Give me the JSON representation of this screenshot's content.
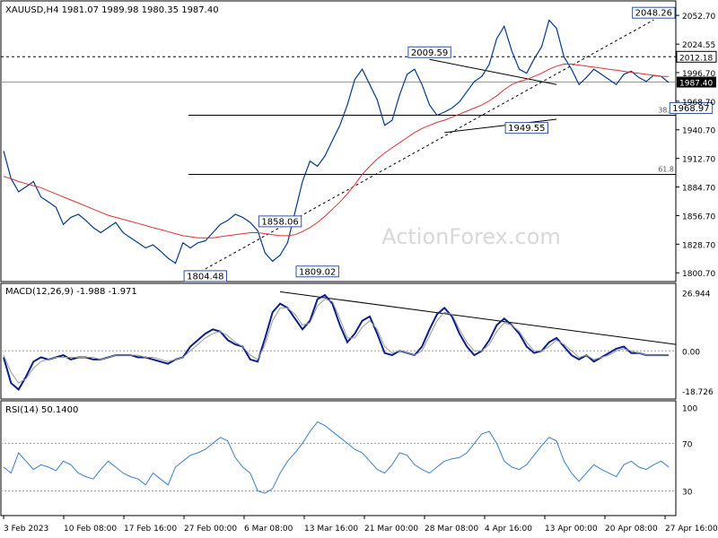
{
  "chart_data": {
    "type": "line",
    "watermark": "ActionForex.com",
    "main": {
      "title": "XAUUSD,H4  1981.07 1989.98 1980.35 1987.40",
      "ylim": [
        1793,
        2066
      ],
      "yticks": [
        "2052.70",
        "2024.55",
        "1996.70",
        "1968.70",
        "1940.70",
        "1912.70",
        "1884.70",
        "1856.70",
        "1828.70",
        "1800.70"
      ],
      "last_price": "1987.40",
      "level_price": "2012.18",
      "fib_levels": [
        {
          "label": "38.2",
          "value": 1955.0
        },
        {
          "label": "61.8",
          "value": 1897.0
        }
      ],
      "annotations": [
        {
          "label": "1804.48",
          "x": 27,
          "value": 1804.48
        },
        {
          "label": "1858.06",
          "x": 37,
          "value": 1858.06
        },
        {
          "label": "1809.02",
          "x": 42,
          "value": 1809.02
        },
        {
          "label": "2009.59",
          "x": 57,
          "value": 2009.59
        },
        {
          "label": "1949.55",
          "x": 70,
          "value": 1949.55
        },
        {
          "label": "2048.26",
          "x": 87,
          "value": 2048.26
        },
        {
          "label": "1968.97",
          "x": 92,
          "value": 1968.97
        }
      ],
      "series": [
        {
          "color": "#003a8c",
          "values": [
            1920,
            1893,
            1880,
            1885,
            1890,
            1875,
            1870,
            1865,
            1848,
            1855,
            1858,
            1852,
            1845,
            1840,
            1845,
            1850,
            1840,
            1835,
            1830,
            1825,
            1828,
            1822,
            1815,
            1810,
            1830,
            1825,
            1830,
            1832,
            1840,
            1848,
            1852,
            1858,
            1855,
            1850,
            1842,
            1820,
            1812,
            1818,
            1830,
            1860,
            1890,
            1910,
            1905,
            1915,
            1930,
            1945,
            1965,
            1990,
            2000,
            1985,
            1970,
            1945,
            1950,
            1975,
            1995,
            2000,
            1985,
            1965,
            1955,
            1958,
            1962,
            1968,
            1978,
            1988,
            1993,
            2005,
            2030,
            2042,
            2018,
            2000,
            1996,
            2010,
            2022,
            2048,
            2040,
            2012,
            2000,
            1985,
            1992,
            2000,
            1995,
            1990,
            1985,
            1995,
            1998,
            1992,
            1988,
            1994,
            1993,
            1987
          ]
        },
        {
          "color": "#e03030",
          "values": [
            1895,
            1893,
            1890,
            1888,
            1886,
            1884,
            1881,
            1878,
            1875,
            1872,
            1869,
            1866,
            1863,
            1860,
            1857,
            1855,
            1853,
            1851,
            1849,
            1847,
            1845,
            1843,
            1841,
            1839,
            1837,
            1836,
            1835,
            1835,
            1835,
            1836,
            1837,
            1838,
            1839,
            1840,
            1840,
            1839,
            1838,
            1837,
            1837,
            1838,
            1841,
            1845,
            1850,
            1856,
            1863,
            1870,
            1878,
            1887,
            1897,
            1905,
            1912,
            1918,
            1923,
            1928,
            1933,
            1938,
            1942,
            1945,
            1948,
            1950,
            1953,
            1956,
            1959,
            1962,
            1965,
            1969,
            1974,
            1980,
            1985,
            1988,
            1990,
            1993,
            1996,
            2000,
            2003,
            2005,
            2005,
            2004,
            2003,
            2002,
            2001,
            2000,
            1999,
            1998,
            1997,
            1996,
            1995,
            1994,
            1993,
            1993
          ]
        }
      ]
    },
    "macd": {
      "title": "MACD(12,26,9) -1.988 -1.971",
      "ylim": [
        -22,
        31
      ],
      "yticks": [
        "26.944",
        "0.00",
        "-18.726"
      ],
      "series": [
        {
          "color": "#0a1e8c",
          "values": [
            -3,
            -15,
            -18,
            -12,
            -5,
            -3,
            -4,
            -3,
            -2,
            -4,
            -3,
            -3,
            -4,
            -4,
            -3,
            -2,
            -2,
            -2,
            -3,
            -3,
            -4,
            -5,
            -6,
            -4,
            -3,
            2,
            5,
            8,
            10,
            9,
            5,
            3,
            2,
            -4,
            -5,
            6,
            18,
            22,
            20,
            15,
            10,
            14,
            24,
            26,
            22,
            12,
            4,
            8,
            14,
            16,
            8,
            -1,
            -2,
            0,
            -1,
            -2,
            2,
            10,
            17,
            20,
            16,
            8,
            2,
            -2,
            0,
            5,
            12,
            15,
            12,
            8,
            2,
            -1,
            0,
            4,
            6,
            2,
            -2,
            -4,
            -2,
            -5,
            -3,
            -1,
            1,
            2,
            -1,
            -1,
            -2,
            -2,
            -2,
            -1.99
          ]
        },
        {
          "color": "#999999",
          "values": [
            -2,
            -10,
            -15,
            -13,
            -8,
            -5,
            -4,
            -3,
            -3,
            -3,
            -3,
            -3,
            -3,
            -4,
            -3,
            -2,
            -2,
            -2,
            -2,
            -3,
            -3,
            -4,
            -5,
            -4,
            -3,
            0,
            3,
            6,
            8,
            9,
            7,
            4,
            2,
            -2,
            -4,
            3,
            14,
            20,
            20,
            17,
            12,
            13,
            21,
            24,
            23,
            15,
            6,
            6,
            11,
            14,
            10,
            2,
            -1,
            0,
            -1,
            -2,
            0,
            7,
            14,
            18,
            17,
            10,
            4,
            0,
            0,
            3,
            9,
            13,
            12,
            9,
            4,
            0,
            0,
            2,
            5,
            3,
            0,
            -3,
            -2,
            -4,
            -3,
            -2,
            0,
            1,
            0,
            -1,
            -2,
            -2,
            -2,
            -1.97
          ]
        }
      ],
      "trendline_start_value": 27.5
    },
    "rsi": {
      "title": "RSI(14) 50.1400",
      "ylim": [
        10,
        105
      ],
      "yticks": [
        "100",
        "70",
        "30"
      ],
      "series": [
        {
          "color": "#3a7ec8",
          "values": [
            50,
            45,
            62,
            55,
            48,
            52,
            50,
            47,
            55,
            52,
            45,
            42,
            40,
            48,
            55,
            50,
            45,
            42,
            40,
            35,
            45,
            40,
            35,
            50,
            55,
            60,
            62,
            65,
            70,
            75,
            72,
            58,
            50,
            45,
            30,
            28,
            32,
            45,
            55,
            62,
            70,
            80,
            88,
            85,
            80,
            75,
            70,
            65,
            62,
            55,
            48,
            45,
            52,
            62,
            60,
            52,
            48,
            45,
            50,
            55,
            57,
            58,
            62,
            70,
            78,
            80,
            70,
            55,
            50,
            48,
            52,
            60,
            68,
            75,
            72,
            55,
            45,
            38,
            45,
            52,
            48,
            45,
            42,
            52,
            55,
            50,
            48,
            52,
            55,
            50.14
          ]
        }
      ]
    },
    "x_axis": {
      "labels": [
        "3 Feb 2023",
        "10 Feb 08:00",
        "17 Feb 16:00",
        "27 Feb 00:00",
        "6 Mar 08:00",
        "13 Mar 16:00",
        "21 Mar 00:00",
        "28 Mar 08:00",
        "4 Apr 16:00",
        "13 Apr 00:00",
        "20 Apr 08:00",
        "27 Apr 16:00"
      ]
    }
  }
}
